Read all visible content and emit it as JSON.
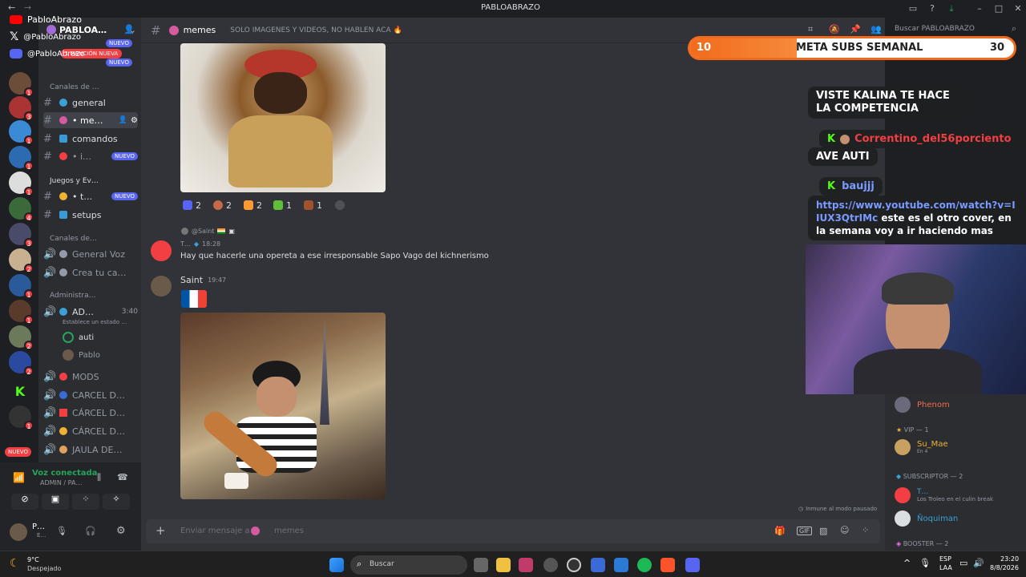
{
  "titlebar": {
    "title": "PABLOABRAZO"
  },
  "social": {
    "youtube": "PabloAbrazo",
    "x": "@PabloAbrazo",
    "discord": "@PabloAbrazo"
  },
  "server": {
    "name": "PABLOA…",
    "mention_banner": "1 MENCIÓN NUEVA",
    "new_badge": "NUEVO"
  },
  "channels": {
    "cat1": "Canales de …",
    "items": [
      {
        "label": "general"
      },
      {
        "label": "• me…"
      },
      {
        "label": "comandos"
      },
      {
        "label": "• i…"
      }
    ],
    "cat2": "Juegos y Ev…",
    "games": [
      {
        "label": "• t…"
      },
      {
        "label": "setups"
      }
    ],
    "cat3": "Canales de…",
    "voice": [
      {
        "label": "General Voz"
      },
      {
        "label": "Crea tu ca…"
      }
    ],
    "cat4": "Administra…",
    "admin": {
      "label": "AD…",
      "time": "3:40",
      "status": "Establece un estado …"
    },
    "voice_users": [
      "auti",
      "Pablo"
    ],
    "more": [
      {
        "label": "MODS"
      },
      {
        "label": "CARCEL D…"
      },
      {
        "label": "CÁRCEL D…"
      },
      {
        "label": "CÁRCEL D…"
      },
      {
        "label": "JAULA DE…"
      }
    ]
  },
  "voicepanel": {
    "status": "Voz conectada",
    "channel": "ADMIN / PA…",
    "user": "P…",
    "user_sub": "E…"
  },
  "chat": {
    "channel": "memes",
    "topic": "SOLO IMAGENES Y VIDEOS, NO HABLEN ACA 🔥",
    "search_placeholder": "Buscar PABLOABRAZO",
    "reactions": [
      {
        "count": "2",
        "color": "#5865f2"
      },
      {
        "count": "2",
        "color": "#c46a4a"
      },
      {
        "count": "2",
        "color": "#ff9933"
      },
      {
        "count": "1",
        "color": "#5fbf3a"
      },
      {
        "count": "1",
        "color": "#a0522d"
      }
    ],
    "reply_user": "@Saint",
    "msg1_user": "T…",
    "msg1_time": "18:28",
    "msg1_text": "Hay que hacerle una opereta a ese irresponsable Sapo Vago del kichnerismo",
    "msg2_user": "Saint",
    "msg2_time": "19:47",
    "immune": "Inmune al modo pausado",
    "composer_placeholder": "Enviar mensaje a #",
    "composer_channel": "memes"
  },
  "overlay": {
    "meta_start": "10",
    "meta_label": "META SUBS SEMANAL",
    "meta_goal": "30",
    "meta_progress": 0.33,
    "chat": [
      {
        "user": "",
        "text": "VISTE KALINA TE HACE LA COMPETENCIA"
      },
      {
        "user": "Correntino_del56porciento",
        "text": "AVE AUTI"
      },
      {
        "user": "baujjj",
        "link": "https://www.youtube.com/watch?v=IIUX3QtrIMc",
        "text": "este es el otro cover, en la semana voy a ir haciendo mas"
      }
    ]
  },
  "members": {
    "phenom": "Phenom",
    "vip": "VIP — 1",
    "vip_user": "Su_Mae",
    "vip_sub": "En 4",
    "subs": "SUBSCRIPTOR — 2",
    "sub_user1": "T…",
    "sub_user1_status": "Los Troleo en el culin break",
    "sub_user2": "Ñoquiman",
    "booster": "BOOSTER — 2"
  },
  "taskbar": {
    "weather_temp": "9°C",
    "weather_desc": "Despejado",
    "search": "Buscar",
    "lang1": "ESP",
    "lang2": "LAA",
    "time": "23:20",
    "date": "8/8/2026"
  }
}
